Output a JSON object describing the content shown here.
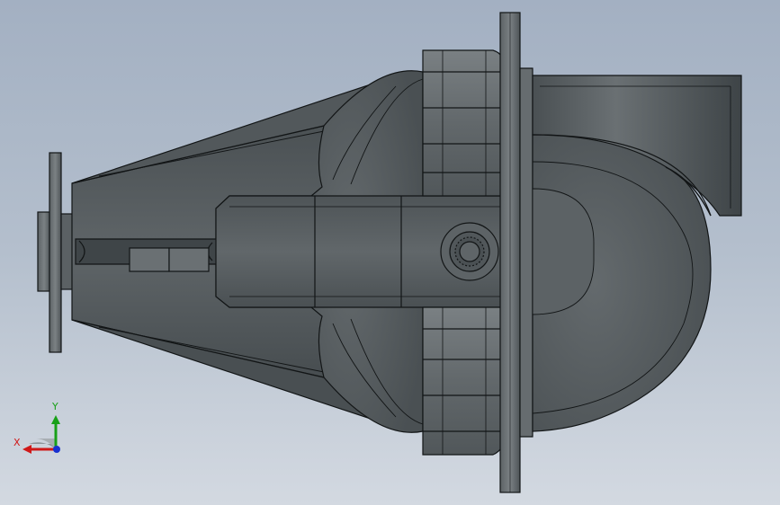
{
  "view": {
    "background_top": "#a3b0c2",
    "background_bottom": "#d3d9e1",
    "model_color": "#5a6064",
    "edge_color": "#121516"
  },
  "triad": {
    "x_label": "X",
    "y_label": "Y",
    "x_color": "#d01818",
    "y_color": "#18a018",
    "z_color": "#1830d0"
  }
}
